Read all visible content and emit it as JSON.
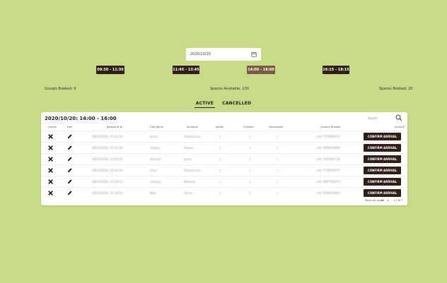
{
  "date_picker": {
    "value": "2020/10/20"
  },
  "time_slots": [
    "09:30 - 11:30",
    "11:45 - 13:45",
    "14:00 - 16:00",
    "16:15 - 18:15"
  ],
  "stats": {
    "groups_booked": "Groups Booked: 9",
    "spaces_available": "Spaces Available: 130",
    "spaces_booked": "Spaces Booked: 20"
  },
  "tabs": [
    "ACTIVE",
    "CANCELLED"
  ],
  "panel": {
    "title": "2020/10/20: 14:00 - 16:00",
    "search_label": "Search",
    "headers": [
      "Cancel",
      "Edit",
      "Booked at",
      "First Name",
      "Surname",
      "Adults",
      "Children",
      "Households",
      "Contact Number",
      "Arrived?"
    ],
    "rows": [
      [
        "09/10/2020, 07:41:10",
        "Karen",
        "Stephenson",
        "2",
        "1",
        "1",
        "+44 7759999137"
      ],
      [
        "09/10/2020, 07:51:46",
        "Angela",
        "Dawes",
        "2",
        "1",
        "1",
        "+44 7949924695"
      ],
      [
        "09/10/2020, 13:02:20",
        "Hannah",
        "Jones",
        "2",
        "1",
        "1",
        "+44 7450307136"
      ],
      [
        "09/10/2020, 20:42:10",
        "Vicki",
        "Stephenson",
        "2",
        "1",
        "1",
        "+44 7776050071"
      ],
      [
        "09/10/2020, 21:29:15",
        "Lindsay",
        "Maxwell",
        "1",
        "1",
        "1",
        "+44 7487769273"
      ],
      [
        "09/10/2020, 21:39:55",
        "Beth",
        "Turner",
        "2",
        "2",
        "1",
        "+44 7446924897"
      ]
    ],
    "confirm_label": "CONFIRM ARRIVAL",
    "footer": {
      "rows_per_page_label": "Rows per page:",
      "rows_per_page": "50",
      "range": "1-7 of 7"
    }
  },
  "colors": {
    "background": "#c8db87",
    "dark_button": "#2f1f17",
    "active_slot": "#7a5a40"
  }
}
